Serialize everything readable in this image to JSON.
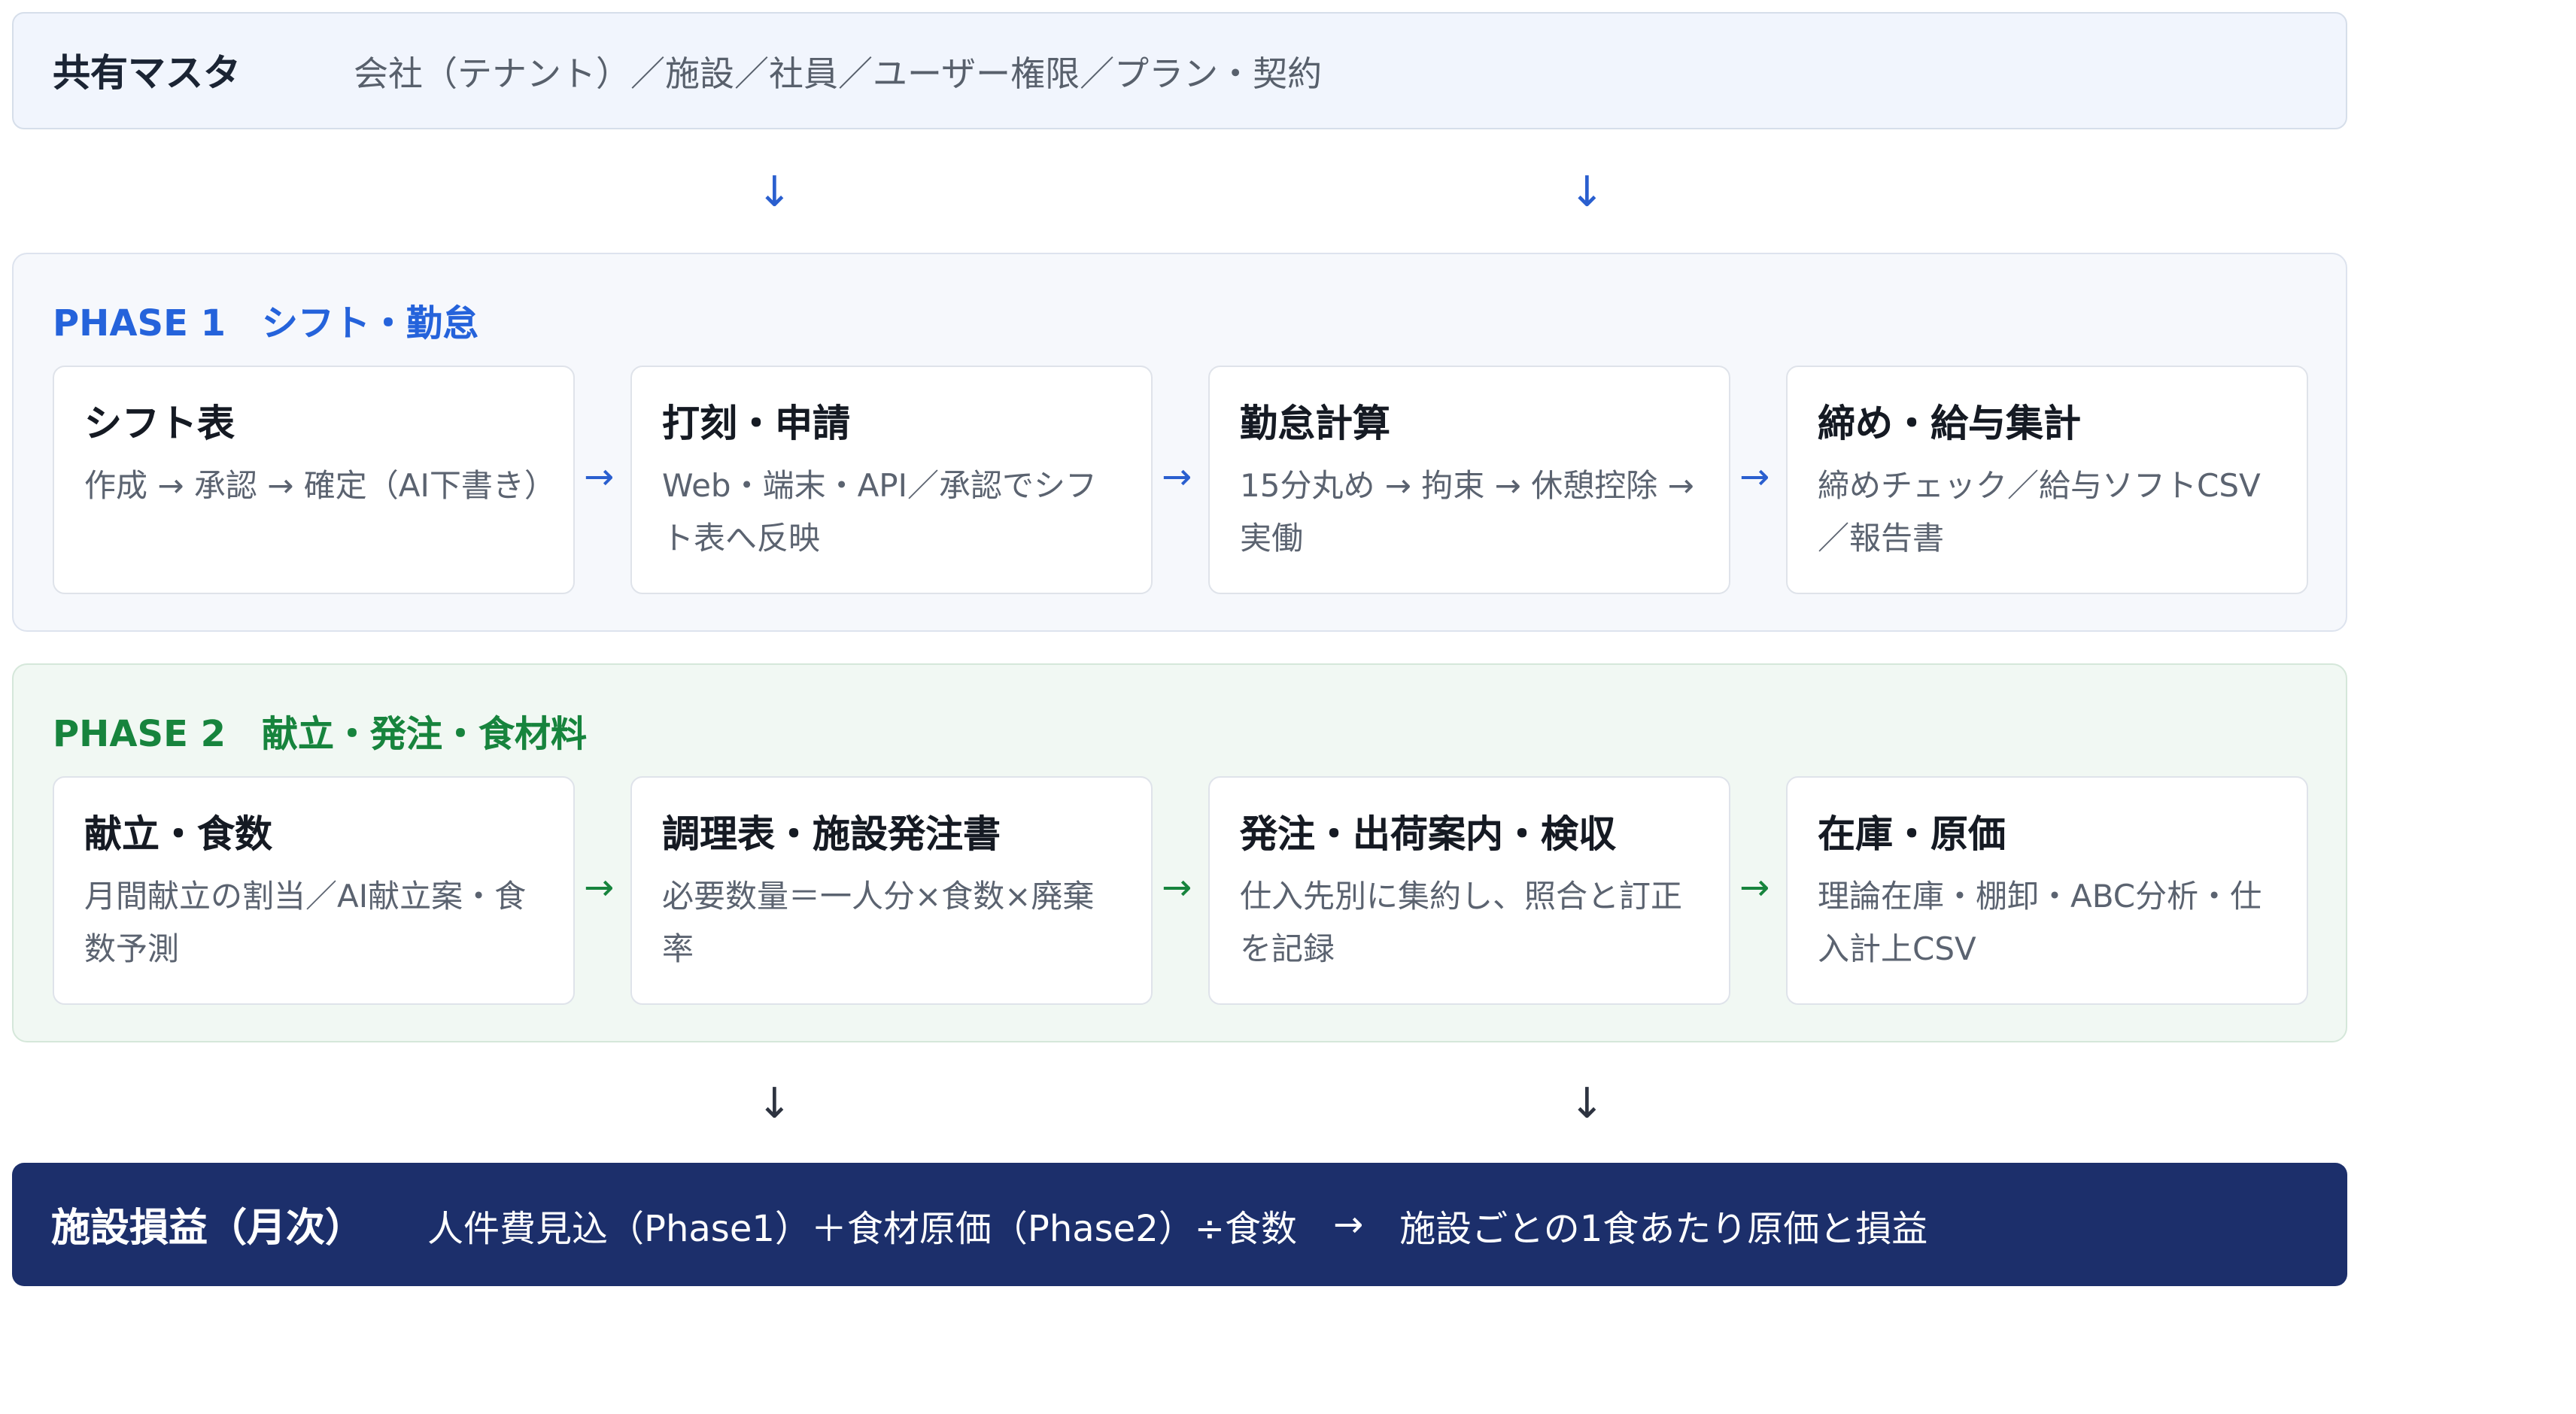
{
  "master": {
    "title": "共有マスタ",
    "items": "会社（テナント）／施設／社員／ユーザー権限／プラン・契約"
  },
  "arrows": {
    "down": "↓",
    "right": "→"
  },
  "phase1": {
    "title": "PHASE 1　シフト・勤怠",
    "accent_color": "#2563db",
    "cards": [
      {
        "title": "シフト表",
        "desc": "作成 → 承認 → 確定（AI下書き）"
      },
      {
        "title": "打刻・申請",
        "desc": "Web・端末・API／承認でシフト表へ反映"
      },
      {
        "title": "勤怠計算",
        "desc": "15分丸め → 拘束 → 休憩控除 → 実働"
      },
      {
        "title": "締め・給与集計",
        "desc": "締めチェック／給与ソフトCSV／報告書"
      }
    ]
  },
  "phase2": {
    "title": "PHASE 2　献立・発注・食材料",
    "accent_color": "#17843d",
    "cards": [
      {
        "title": "献立・食数",
        "desc": "月間献立の割当／AI献立案・食数予測"
      },
      {
        "title": "調理表・施設発注書",
        "desc": "必要数量＝一人分×食数×廃棄率"
      },
      {
        "title": "発注・出荷案内・検収",
        "desc": "仕入先別に集約し、照合と訂正を記録"
      },
      {
        "title": "在庫・原価",
        "desc": "理論在庫・棚卸・ABC分析・仕入計上CSV"
      }
    ]
  },
  "profit": {
    "title": "施設損益（月次）",
    "formula": "人件費見込（Phase1）＋食材原価（Phase2）÷食数",
    "arrow": "→",
    "result": "施設ごとの1食あたり原価と損益",
    "background_color": "#1c2f6b"
  }
}
